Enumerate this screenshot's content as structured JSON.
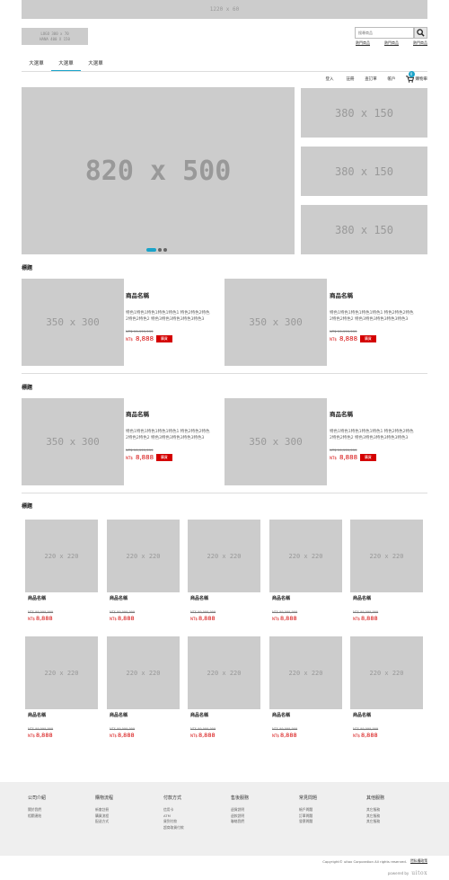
{
  "top_banner": "1220 x 60",
  "logo": {
    "line1": "LOGO 300 x 70",
    "line2": "HANA 400 X 150"
  },
  "search": {
    "placeholder": "搜尋商品",
    "hot_links": [
      "熱門商品",
      "熱門商品",
      "熱門商品"
    ]
  },
  "tabs": [
    "大選單",
    "大選單",
    "大選單"
  ],
  "user_nav": {
    "links": [
      "登入",
      "註冊",
      "查訂單",
      "帳戶"
    ],
    "cart_label": "購物車",
    "cart_count": "0"
  },
  "hero": {
    "main": "820 x 500",
    "side": [
      "380 x 150",
      "380 x 150",
      "380 x 150"
    ]
  },
  "section1": {
    "title": "標題",
    "products": [
      {
        "img": "350 x 300",
        "name": "商品名稱",
        "desc": "特色1特色1特色1特色1特色1 特色2特色2特色2特色2特色2 特色3特色3特色3特色3特色3",
        "old_price": "NT$ 99,999,999",
        "currency": "NT$",
        "price": "8,888",
        "buy": "購買"
      },
      {
        "img": "350 x 300",
        "name": "商品名稱",
        "desc": "特色1特色1特色1特色1特色1 特色2特色2特色2特色2特色2 特色3特色3特色3特色3特色3",
        "old_price": "NT$ 99,999,999",
        "currency": "NT$",
        "price": "8,888",
        "buy": "購買"
      }
    ]
  },
  "section2": {
    "title": "標題",
    "products": [
      {
        "img": "350 x 300",
        "name": "商品名稱",
        "desc": "特色1特色1特色1特色1特色1 特色2特色2特色2特色2特色2 特色3特色3特色3特色3特色3",
        "old_price": "NT$ 99,999,999",
        "currency": "NT$",
        "price": "8,888",
        "buy": "購買"
      },
      {
        "img": "350 x 300",
        "name": "商品名稱",
        "desc": "特色1特色1特色1特色1特色1 特色2特色2特色2特色2特色2 特色3特色3特色3特色3特色3",
        "old_price": "NT$ 99,999,999",
        "currency": "NT$",
        "price": "8,888",
        "buy": "購買"
      }
    ]
  },
  "section3": {
    "title": "標題",
    "rows": [
      [
        {
          "img": "220 x 220",
          "name": "商品名稱",
          "old_price": "NT$ 99,999,999",
          "currency": "NT$",
          "price": "8,888"
        },
        {
          "img": "220 x 220",
          "name": "商品名稱",
          "old_price": "NT$ 99,999,999",
          "currency": "NT$",
          "price": "8,888"
        },
        {
          "img": "220 x 220",
          "name": "商品名稱",
          "old_price": "NT$ 99,999,999",
          "currency": "NT$",
          "price": "8,888"
        },
        {
          "img": "220 x 220",
          "name": "商品名稱",
          "old_price": "NT$ 99,999,999",
          "currency": "NT$",
          "price": "8,888"
        },
        {
          "img": "220 x 220",
          "name": "商品名稱",
          "old_price": "NT$ 99,999,999",
          "currency": "NT$",
          "price": "8,888"
        }
      ],
      [
        {
          "img": "220 x 220",
          "name": "商品名稱",
          "old_price": "NT$ 99,999,999",
          "currency": "NT$",
          "price": "8,888"
        },
        {
          "img": "220 x 220",
          "name": "商品名稱",
          "old_price": "NT$ 99,999,999",
          "currency": "NT$",
          "price": "8,888"
        },
        {
          "img": "220 x 220",
          "name": "商品名稱",
          "old_price": "NT$ 99,999,999",
          "currency": "NT$",
          "price": "8,888"
        },
        {
          "img": "220 x 220",
          "name": "商品名稱",
          "old_price": "NT$ 99,999,999",
          "currency": "NT$",
          "price": "8,888"
        },
        {
          "img": "220 x 220",
          "name": "商品名稱",
          "old_price": "NT$ 99,999,999",
          "currency": "NT$",
          "price": "8,888"
        }
      ]
    ]
  },
  "footer": {
    "columns": [
      {
        "title": "公司介紹",
        "items": [
          "關於我們",
          "相關連結"
        ]
      },
      {
        "title": "購物流程",
        "items": [
          "新會註冊",
          "購買流程",
          "配送方式"
        ]
      },
      {
        "title": "付款方式",
        "items": [
          "信用卡",
          "ATM",
          "貨到付款",
          "超商取貨付款"
        ]
      },
      {
        "title": "售後服務",
        "items": [
          "退貨說明",
          "退款說明",
          "聯絡我們"
        ]
      },
      {
        "title": "常見問題",
        "items": [
          "帳戶問題",
          "訂單問題",
          "發票問題"
        ]
      },
      {
        "title": "其他服務",
        "items": [
          "其它服務",
          "其它服務",
          "其它服務"
        ]
      }
    ],
    "copyright": "Copyright© uitox Corporation All rights reserved.",
    "privacy": "隱私權政策",
    "powered_by": "powered by",
    "brand": "uitox"
  },
  "colors": {
    "accent": "#1aa3c9",
    "price_red": "#d40000",
    "placeholder_gray": "#cccccc",
    "footer_bg": "#efefef"
  }
}
